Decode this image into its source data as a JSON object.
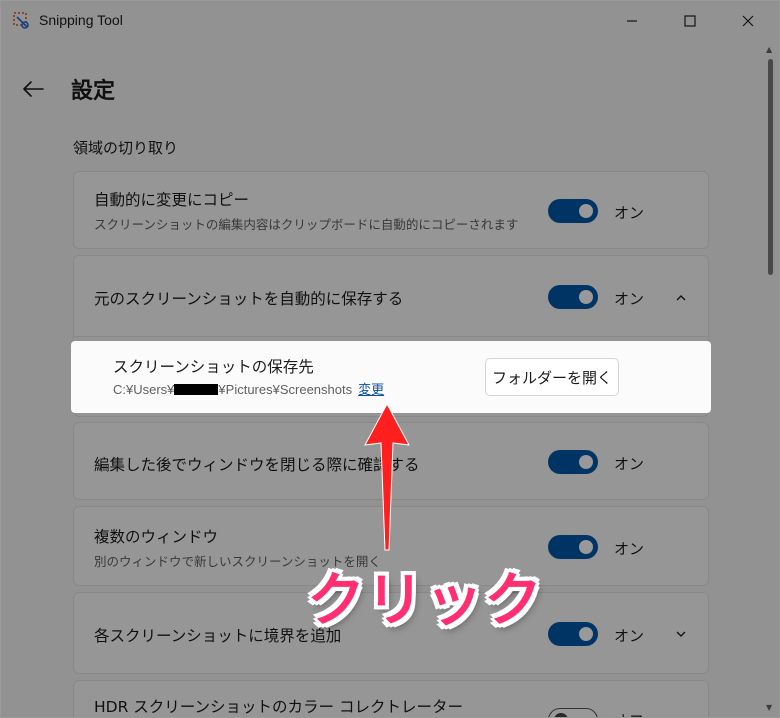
{
  "window": {
    "title": "Snipping Tool"
  },
  "page": {
    "title": "設定",
    "section_title": "領域の切り取り"
  },
  "settings": [
    {
      "title": "自動的に変更にコピー",
      "description": "スクリーンショットの編集内容はクリップボードに自動的にコピーされます",
      "state": "オン"
    },
    {
      "title": "元のスクリーンショットを自動的に保存する",
      "state": "オン"
    },
    {
      "title": "編集した後でウィンドウを閉じる際に確認する",
      "state": "オン"
    },
    {
      "title": "複数のウィンドウ",
      "description": "別のウィンドウで新しいスクリーンショットを開く",
      "state": "オン"
    },
    {
      "title": "各スクリーンショットに境界を追加",
      "state": "オン"
    },
    {
      "title": "HDR スクリーンショットのカラー コレクトレーター",
      "state": "オフ"
    }
  ],
  "save_location": {
    "title": "スクリーンショットの保存先",
    "path_prefix": "C:¥Users¥",
    "path_suffix": "¥Pictures¥Screenshots",
    "change_label": "変更",
    "open_folder_label": "フォルダーを開く"
  },
  "annotation": {
    "callout": "クリック",
    "color": "#ff2f72"
  },
  "colors": {
    "accent": "#0058a8",
    "link": "#0a52a8"
  },
  "icons": [
    "snipping-tool-icon",
    "back-arrow-icon",
    "chevron-up-icon",
    "chevron-down-icon",
    "minimize-icon",
    "maximize-icon",
    "close-icon"
  ]
}
